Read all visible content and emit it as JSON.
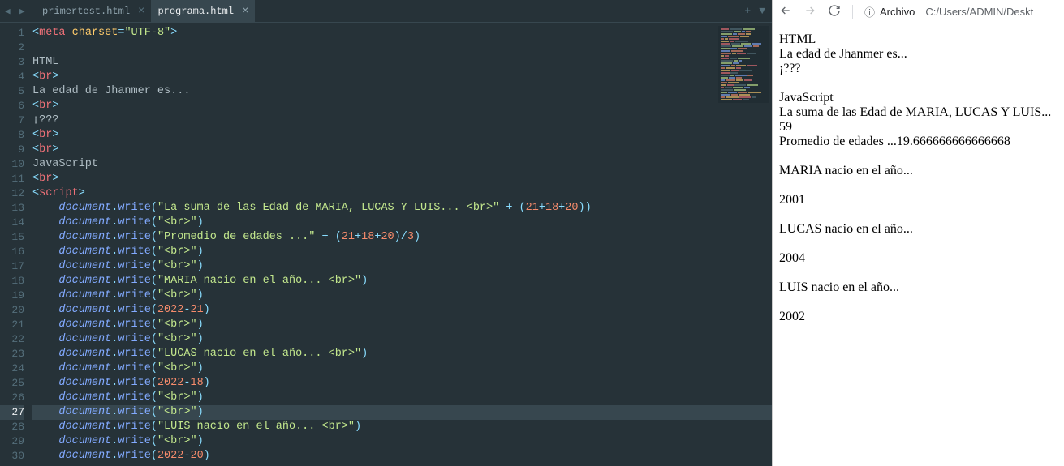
{
  "editor": {
    "tabs": [
      {
        "label": "primertest.html",
        "active": false
      },
      {
        "label": "programa.html",
        "active": true
      }
    ],
    "lines": [
      {
        "num": 1,
        "segments": [
          {
            "t": "<",
            "c": "punct"
          },
          {
            "t": "meta",
            "c": "tag"
          },
          {
            "t": " ",
            "c": "plain"
          },
          {
            "t": "charset",
            "c": "attr"
          },
          {
            "t": "=",
            "c": "punct"
          },
          {
            "t": "\"UTF-8\"",
            "c": "string"
          },
          {
            "t": ">",
            "c": "punct"
          }
        ]
      },
      {
        "num": 2,
        "segments": []
      },
      {
        "num": 3,
        "segments": [
          {
            "t": "HTML",
            "c": "text"
          }
        ]
      },
      {
        "num": 4,
        "segments": [
          {
            "t": "<",
            "c": "punct"
          },
          {
            "t": "br",
            "c": "tag"
          },
          {
            "t": ">",
            "c": "punct"
          }
        ]
      },
      {
        "num": 5,
        "segments": [
          {
            "t": "La edad de Jhanmer es...",
            "c": "text"
          }
        ]
      },
      {
        "num": 6,
        "segments": [
          {
            "t": "<",
            "c": "punct"
          },
          {
            "t": "br",
            "c": "tag"
          },
          {
            "t": ">",
            "c": "punct"
          }
        ]
      },
      {
        "num": 7,
        "segments": [
          {
            "t": "¡???",
            "c": "text"
          }
        ]
      },
      {
        "num": 8,
        "segments": [
          {
            "t": "<",
            "c": "punct"
          },
          {
            "t": "br",
            "c": "tag"
          },
          {
            "t": ">",
            "c": "punct"
          }
        ]
      },
      {
        "num": 9,
        "segments": [
          {
            "t": "<",
            "c": "punct"
          },
          {
            "t": "br",
            "c": "tag"
          },
          {
            "t": ">",
            "c": "punct"
          }
        ]
      },
      {
        "num": 10,
        "segments": [
          {
            "t": "JavaScript",
            "c": "text"
          }
        ]
      },
      {
        "num": 11,
        "segments": [
          {
            "t": "<",
            "c": "punct"
          },
          {
            "t": "br",
            "c": "tag"
          },
          {
            "t": ">",
            "c": "punct"
          }
        ]
      },
      {
        "num": 12,
        "segments": [
          {
            "t": "<",
            "c": "punct"
          },
          {
            "t": "script",
            "c": "tag"
          },
          {
            "t": ">",
            "c": "punct"
          }
        ]
      },
      {
        "num": 13,
        "segments": [
          {
            "t": "    ",
            "c": "plain"
          },
          {
            "t": "document",
            "c": "keyword-ident"
          },
          {
            "t": ".",
            "c": "punct"
          },
          {
            "t": "write",
            "c": "method"
          },
          {
            "t": "(",
            "c": "punct"
          },
          {
            "t": "\"La suma de las Edad de MARIA, LUCAS Y LUIS... <br>\"",
            "c": "string"
          },
          {
            "t": " + ",
            "c": "operator"
          },
          {
            "t": "(",
            "c": "punct"
          },
          {
            "t": "21",
            "c": "number"
          },
          {
            "t": "+",
            "c": "operator"
          },
          {
            "t": "18",
            "c": "number"
          },
          {
            "t": "+",
            "c": "operator"
          },
          {
            "t": "20",
            "c": "number"
          },
          {
            "t": ")",
            "c": "punct"
          },
          {
            "t": ")",
            "c": "punct"
          }
        ]
      },
      {
        "num": 14,
        "segments": [
          {
            "t": "    ",
            "c": "plain"
          },
          {
            "t": "document",
            "c": "keyword-ident"
          },
          {
            "t": ".",
            "c": "punct"
          },
          {
            "t": "write",
            "c": "method"
          },
          {
            "t": "(",
            "c": "punct"
          },
          {
            "t": "\"<br>\"",
            "c": "string"
          },
          {
            "t": ")",
            "c": "punct"
          }
        ]
      },
      {
        "num": 15,
        "segments": [
          {
            "t": "    ",
            "c": "plain"
          },
          {
            "t": "document",
            "c": "keyword-ident"
          },
          {
            "t": ".",
            "c": "punct"
          },
          {
            "t": "write",
            "c": "method"
          },
          {
            "t": "(",
            "c": "punct"
          },
          {
            "t": "\"Promedio de edades ...\"",
            "c": "string"
          },
          {
            "t": " + ",
            "c": "operator"
          },
          {
            "t": "(",
            "c": "punct"
          },
          {
            "t": "21",
            "c": "number"
          },
          {
            "t": "+",
            "c": "operator"
          },
          {
            "t": "18",
            "c": "number"
          },
          {
            "t": "+",
            "c": "operator"
          },
          {
            "t": "20",
            "c": "number"
          },
          {
            "t": ")",
            "c": "punct"
          },
          {
            "t": "/",
            "c": "operator"
          },
          {
            "t": "3",
            "c": "number"
          },
          {
            "t": ")",
            "c": "punct"
          }
        ]
      },
      {
        "num": 16,
        "segments": [
          {
            "t": "    ",
            "c": "plain"
          },
          {
            "t": "document",
            "c": "keyword-ident"
          },
          {
            "t": ".",
            "c": "punct"
          },
          {
            "t": "write",
            "c": "method"
          },
          {
            "t": "(",
            "c": "punct"
          },
          {
            "t": "\"<br>\"",
            "c": "string"
          },
          {
            "t": ")",
            "c": "punct"
          }
        ]
      },
      {
        "num": 17,
        "segments": [
          {
            "t": "    ",
            "c": "plain"
          },
          {
            "t": "document",
            "c": "keyword-ident"
          },
          {
            "t": ".",
            "c": "punct"
          },
          {
            "t": "write",
            "c": "method"
          },
          {
            "t": "(",
            "c": "punct"
          },
          {
            "t": "\"<br>\"",
            "c": "string"
          },
          {
            "t": ")",
            "c": "punct"
          }
        ]
      },
      {
        "num": 18,
        "segments": [
          {
            "t": "    ",
            "c": "plain"
          },
          {
            "t": "document",
            "c": "keyword-ident"
          },
          {
            "t": ".",
            "c": "punct"
          },
          {
            "t": "write",
            "c": "method"
          },
          {
            "t": "(",
            "c": "punct"
          },
          {
            "t": "\"MARIA nacio en el año... <br>\"",
            "c": "string"
          },
          {
            "t": ")",
            "c": "punct"
          }
        ]
      },
      {
        "num": 19,
        "segments": [
          {
            "t": "    ",
            "c": "plain"
          },
          {
            "t": "document",
            "c": "keyword-ident"
          },
          {
            "t": ".",
            "c": "punct"
          },
          {
            "t": "write",
            "c": "method"
          },
          {
            "t": "(",
            "c": "punct"
          },
          {
            "t": "\"<br>\"",
            "c": "string"
          },
          {
            "t": ")",
            "c": "punct"
          }
        ]
      },
      {
        "num": 20,
        "segments": [
          {
            "t": "    ",
            "c": "plain"
          },
          {
            "t": "document",
            "c": "keyword-ident"
          },
          {
            "t": ".",
            "c": "punct"
          },
          {
            "t": "write",
            "c": "method"
          },
          {
            "t": "(",
            "c": "punct"
          },
          {
            "t": "2022",
            "c": "number"
          },
          {
            "t": "-",
            "c": "operator"
          },
          {
            "t": "21",
            "c": "number"
          },
          {
            "t": ")",
            "c": "punct"
          }
        ]
      },
      {
        "num": 21,
        "segments": [
          {
            "t": "    ",
            "c": "plain"
          },
          {
            "t": "document",
            "c": "keyword-ident"
          },
          {
            "t": ".",
            "c": "punct"
          },
          {
            "t": "write",
            "c": "method"
          },
          {
            "t": "(",
            "c": "punct"
          },
          {
            "t": "\"<br>\"",
            "c": "string"
          },
          {
            "t": ")",
            "c": "punct"
          }
        ]
      },
      {
        "num": 22,
        "segments": [
          {
            "t": "    ",
            "c": "plain"
          },
          {
            "t": "document",
            "c": "keyword-ident"
          },
          {
            "t": ".",
            "c": "punct"
          },
          {
            "t": "write",
            "c": "method"
          },
          {
            "t": "(",
            "c": "punct"
          },
          {
            "t": "\"<br>\"",
            "c": "string"
          },
          {
            "t": ")",
            "c": "punct"
          }
        ]
      },
      {
        "num": 23,
        "segments": [
          {
            "t": "    ",
            "c": "plain"
          },
          {
            "t": "document",
            "c": "keyword-ident"
          },
          {
            "t": ".",
            "c": "punct"
          },
          {
            "t": "write",
            "c": "method"
          },
          {
            "t": "(",
            "c": "punct"
          },
          {
            "t": "\"LUCAS nacio en el año... <br>\"",
            "c": "string"
          },
          {
            "t": ")",
            "c": "punct"
          }
        ]
      },
      {
        "num": 24,
        "segments": [
          {
            "t": "    ",
            "c": "plain"
          },
          {
            "t": "document",
            "c": "keyword-ident"
          },
          {
            "t": ".",
            "c": "punct"
          },
          {
            "t": "write",
            "c": "method"
          },
          {
            "t": "(",
            "c": "punct"
          },
          {
            "t": "\"<br>\"",
            "c": "string"
          },
          {
            "t": ")",
            "c": "punct"
          }
        ]
      },
      {
        "num": 25,
        "segments": [
          {
            "t": "    ",
            "c": "plain"
          },
          {
            "t": "document",
            "c": "keyword-ident"
          },
          {
            "t": ".",
            "c": "punct"
          },
          {
            "t": "write",
            "c": "method"
          },
          {
            "t": "(",
            "c": "punct"
          },
          {
            "t": "2022",
            "c": "number"
          },
          {
            "t": "-",
            "c": "operator"
          },
          {
            "t": "18",
            "c": "number"
          },
          {
            "t": ")",
            "c": "punct"
          }
        ]
      },
      {
        "num": 26,
        "segments": [
          {
            "t": "    ",
            "c": "plain"
          },
          {
            "t": "document",
            "c": "keyword-ident"
          },
          {
            "t": ".",
            "c": "punct"
          },
          {
            "t": "write",
            "c": "method"
          },
          {
            "t": "(",
            "c": "punct"
          },
          {
            "t": "\"<br>\"",
            "c": "string"
          },
          {
            "t": ")",
            "c": "punct"
          }
        ]
      },
      {
        "num": 27,
        "hl": true,
        "segments": [
          {
            "t": "    ",
            "c": "plain"
          },
          {
            "t": "document",
            "c": "keyword-ident"
          },
          {
            "t": ".",
            "c": "punct"
          },
          {
            "t": "write",
            "c": "method"
          },
          {
            "t": "(",
            "c": "punct"
          },
          {
            "t": "\"<br>\"",
            "c": "string"
          },
          {
            "t": ")",
            "c": "punct"
          }
        ]
      },
      {
        "num": 28,
        "segments": [
          {
            "t": "    ",
            "c": "plain"
          },
          {
            "t": "document",
            "c": "keyword-ident"
          },
          {
            "t": ".",
            "c": "punct"
          },
          {
            "t": "write",
            "c": "method"
          },
          {
            "t": "(",
            "c": "punct"
          },
          {
            "t": "\"LUIS nacio en el año... <br>\"",
            "c": "string"
          },
          {
            "t": ")",
            "c": "punct"
          }
        ]
      },
      {
        "num": 29,
        "segments": [
          {
            "t": "    ",
            "c": "plain"
          },
          {
            "t": "document",
            "c": "keyword-ident"
          },
          {
            "t": ".",
            "c": "punct"
          },
          {
            "t": "write",
            "c": "method"
          },
          {
            "t": "(",
            "c": "punct"
          },
          {
            "t": "\"<br>\"",
            "c": "string"
          },
          {
            "t": ")",
            "c": "punct"
          }
        ]
      },
      {
        "num": 30,
        "segments": [
          {
            "t": "    ",
            "c": "plain"
          },
          {
            "t": "document",
            "c": "keyword-ident"
          },
          {
            "t": ".",
            "c": "punct"
          },
          {
            "t": "write",
            "c": "method"
          },
          {
            "t": "(",
            "c": "punct"
          },
          {
            "t": "2022",
            "c": "number"
          },
          {
            "t": "-",
            "c": "operator"
          },
          {
            "t": "20",
            "c": "number"
          },
          {
            "t": ")",
            "c": "punct"
          }
        ]
      }
    ]
  },
  "browser": {
    "urlLabel": "Archivo",
    "urlPath": "C:/Users/ADMIN/Deskt",
    "content": [
      "HTML",
      "La edad de Jhanmer es...",
      "¡???",
      "",
      "JavaScript",
      "La suma de las Edad de MARIA, LUCAS Y LUIS...",
      "59",
      "Promedio de edades ...19.666666666666668",
      "",
      "MARIA nacio en el año...",
      "",
      "2001",
      "",
      "LUCAS nacio en el año...",
      "",
      "2004",
      "",
      "LUIS nacio en el año...",
      "",
      "2002"
    ]
  }
}
